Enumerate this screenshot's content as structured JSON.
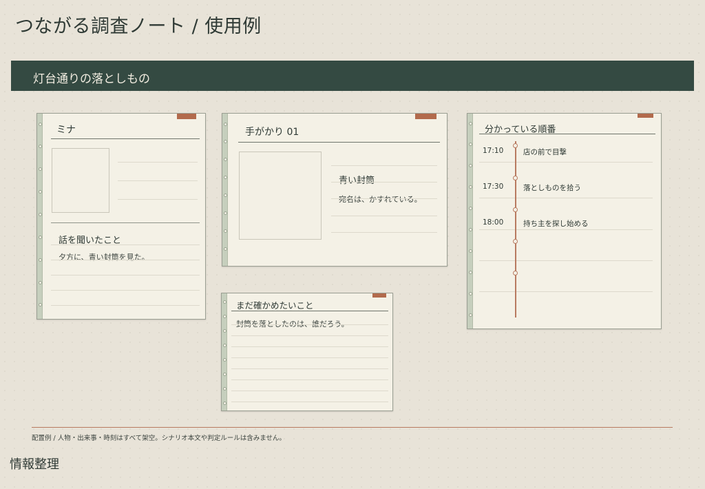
{
  "page": {
    "title": "つながる調査ノート / 使用例"
  },
  "banner": {
    "title": "灯台通りの落としもの"
  },
  "cards": {
    "person": {
      "title": "ミナ",
      "section_label": "話を聞いたこと",
      "note": "夕方に、青い封筒を見た。"
    },
    "clue": {
      "title": "手がかり 01",
      "item_name": "青い封筒",
      "item_note": "宛名は、かすれている。"
    },
    "questions": {
      "title": "まだ確かめたいこと",
      "note": "封筒を落としたのは、誰だろう。"
    },
    "timeline": {
      "title": "分かっている順番",
      "events": [
        {
          "time": "17:10",
          "text": "店の前で目撃"
        },
        {
          "time": "17:30",
          "text": "落としものを拾う"
        },
        {
          "time": "18:00",
          "text": "持ち主を探し始める"
        }
      ]
    }
  },
  "footer": {
    "note": "配置例 / 人物・出来事・時刻はすべて架空。シナリオ本文や判定ルールは含みません。",
    "label": "情報整理"
  },
  "colors": {
    "background": "#e8e3d8",
    "banner": "#344a42",
    "card": "#f4f1e6",
    "accent": "#b26a4c",
    "spine": "#c6cfbd"
  }
}
